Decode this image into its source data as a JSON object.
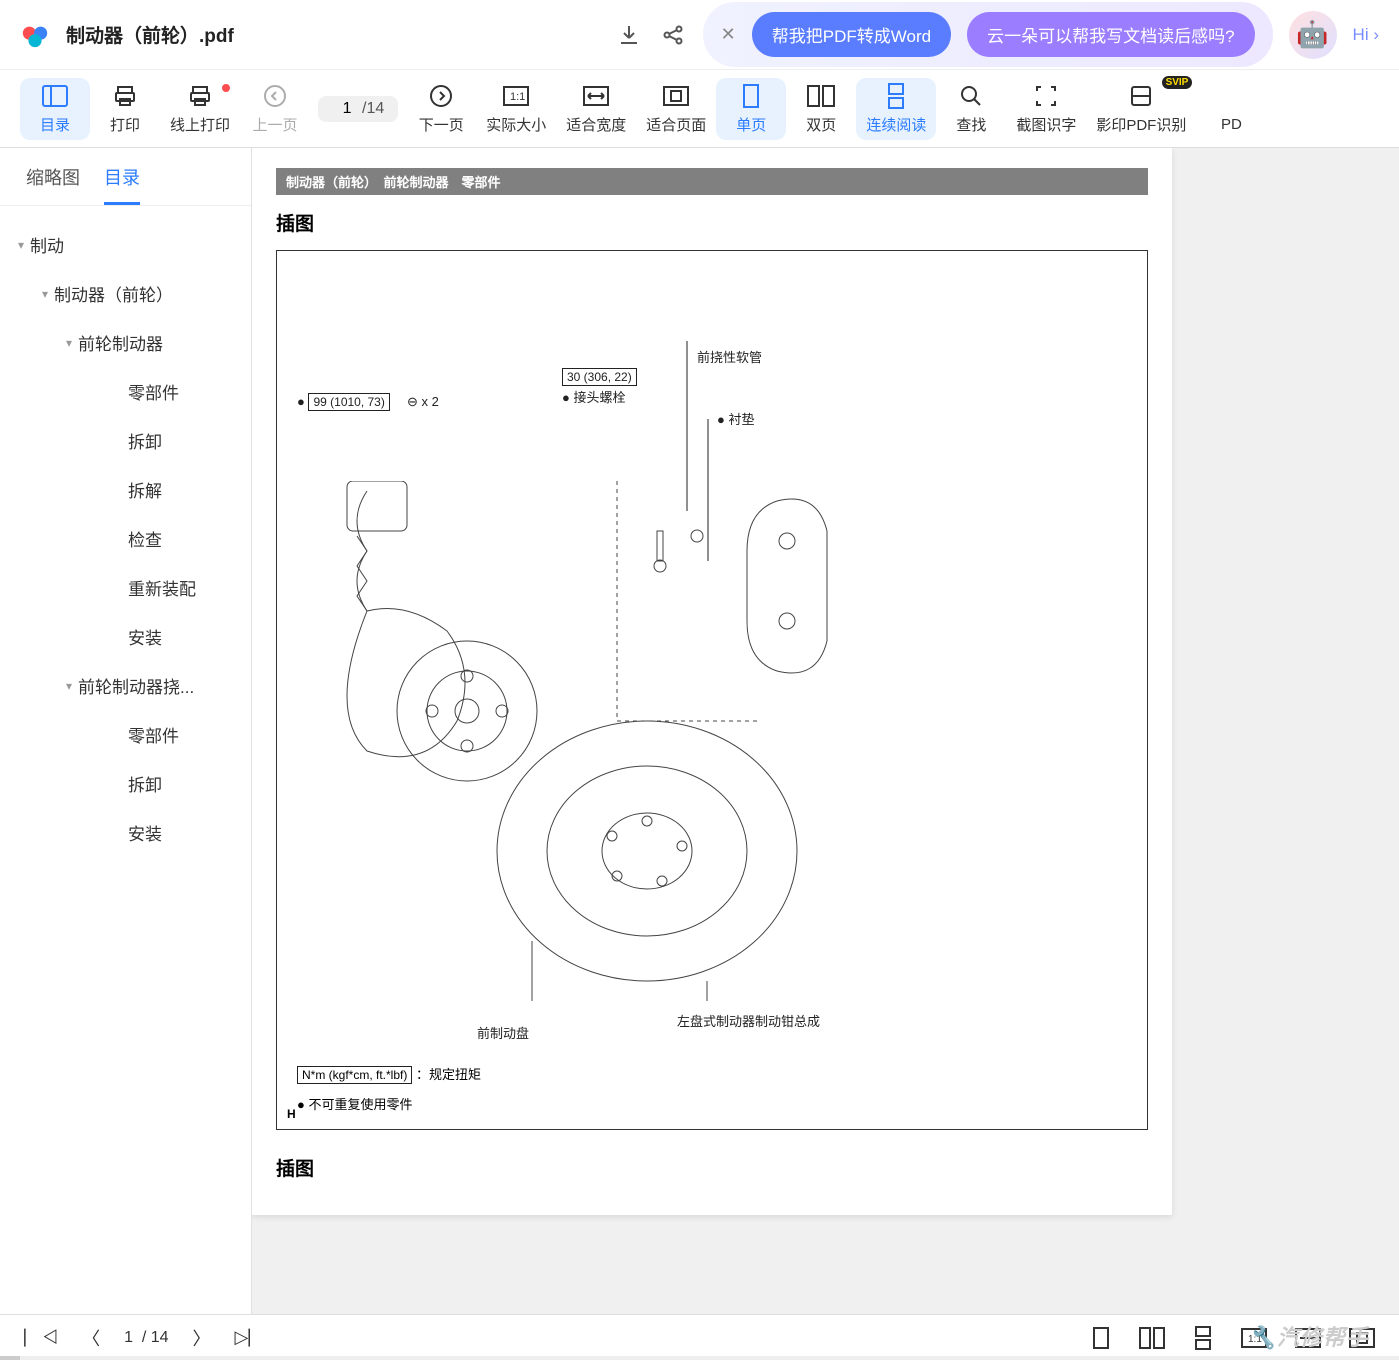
{
  "title": "制动器（前轮）.pdf",
  "pills": {
    "p1": "帮我把PDF转成Word",
    "p2": "云一朵可以帮我写文档读后感吗?"
  },
  "hi": "Hi ›",
  "toolbar": {
    "catalog": "目录",
    "print": "打印",
    "online_print": "线上打印",
    "prev": "上一页",
    "next": "下一页",
    "actual": "实际大小",
    "fit_width": "适合宽度",
    "fit_page": "适合页面",
    "single": "单页",
    "double": "双页",
    "continuous": "连续阅读",
    "find": "查找",
    "ocr": "截图识字",
    "scan": "影印PDF识别",
    "pdf": "PD",
    "page_current": "1",
    "page_total": "14",
    "svip": "SVIP"
  },
  "side_tabs": {
    "thumb": "缩略图",
    "toc": "目录"
  },
  "tree": [
    {
      "label": "制动",
      "depth": 0,
      "caret": true
    },
    {
      "label": "制动器（前轮）",
      "depth": 1,
      "caret": true
    },
    {
      "label": "前轮制动器",
      "depth": 2,
      "caret": true
    },
    {
      "label": "零部件",
      "depth": 3
    },
    {
      "label": "拆卸",
      "depth": 3
    },
    {
      "label": "拆解",
      "depth": 3
    },
    {
      "label": "检查",
      "depth": 3
    },
    {
      "label": "重新装配",
      "depth": 3
    },
    {
      "label": "安装",
      "depth": 3
    },
    {
      "label": "前轮制动器挠...",
      "depth": 2,
      "caret": true
    },
    {
      "label": "零部件",
      "depth": 3
    },
    {
      "label": "拆卸",
      "depth": 3
    },
    {
      "label": "安装",
      "depth": 3
    }
  ],
  "doc": {
    "header": "制动器（前轮）　前轮制动器　零部件",
    "section": "插图",
    "labels": {
      "hose": "前挠性软管",
      "bolt_val": "30 (306, 22)",
      "bolt": "接头螺栓",
      "torque_val": "99 (1010, 73)",
      "x2": "x 2",
      "gasket": "衬垫",
      "caliper": "左盘式制动器制动钳总成",
      "disc": "前制动盘",
      "legend1_box": "N*m (kgf*cm, ft.*lbf)",
      "legend1_txt": "：规定扭矩",
      "legend2": "不可重复使用零件",
      "h": "H"
    },
    "section2": "插图"
  },
  "bottom": {
    "page": "1",
    "sep": "/ 14"
  },
  "watermark": "汽修帮手"
}
